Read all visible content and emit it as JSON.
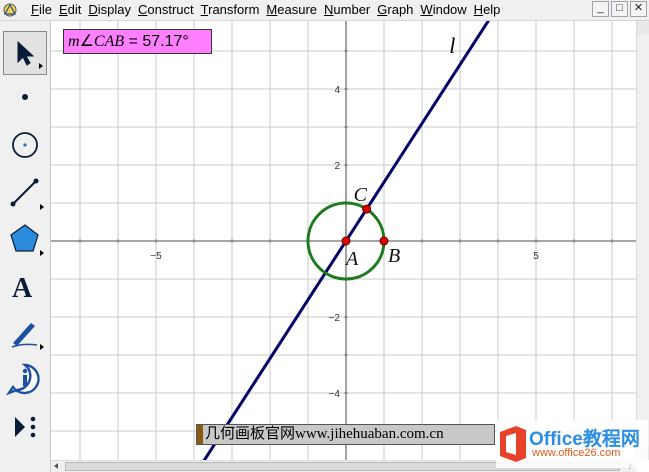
{
  "menu": {
    "items": [
      {
        "pre": "",
        "ul": "F",
        "post": "ile"
      },
      {
        "pre": "",
        "ul": "E",
        "post": "dit"
      },
      {
        "pre": "",
        "ul": "D",
        "post": "isplay"
      },
      {
        "pre": "",
        "ul": "C",
        "post": "onstruct"
      },
      {
        "pre": "",
        "ul": "T",
        "post": "ransform"
      },
      {
        "pre": "",
        "ul": "M",
        "post": "easure"
      },
      {
        "pre": "",
        "ul": "N",
        "post": "umber"
      },
      {
        "pre": "",
        "ul": "G",
        "post": "raph"
      },
      {
        "pre": "",
        "ul": "W",
        "post": "indow"
      },
      {
        "pre": "",
        "ul": "H",
        "post": "elp"
      }
    ],
    "window_buttons": [
      "_",
      "□",
      "✕"
    ]
  },
  "toolbox": {
    "tools": [
      {
        "name": "arrow-select-tool",
        "icon": "arrow-icon",
        "active": true
      },
      {
        "name": "point-tool",
        "icon": "point-icon",
        "active": false
      },
      {
        "name": "compass-tool",
        "icon": "compass-circle-icon",
        "active": false
      },
      {
        "name": "straightedge-tool",
        "icon": "segment-icon",
        "active": false
      },
      {
        "name": "polygon-tool",
        "icon": "polygon-icon",
        "active": false
      },
      {
        "name": "text-tool",
        "icon": "text-a-icon",
        "active": false
      },
      {
        "name": "marker-tool",
        "icon": "pen-icon",
        "active": false
      },
      {
        "name": "information-tool",
        "icon": "info-icon",
        "active": false
      },
      {
        "name": "custom-tool",
        "icon": "custom-tool-icon",
        "active": false
      }
    ],
    "text_tool_glyph": "A"
  },
  "measurement": {
    "m": "m",
    "angle": "∠",
    "name": "CAB",
    "value": " = 57.17°"
  },
  "graph": {
    "x_ticks": [
      "−5",
      "5"
    ],
    "y_ticks": [
      "4",
      "2",
      "−2",
      "−4"
    ],
    "x_range": [
      -5,
      5
    ],
    "origin_label_hint": "A",
    "points": [
      {
        "label": "A",
        "x": 0,
        "y": 0
      },
      {
        "label": "B",
        "x": 1,
        "y": 0
      },
      {
        "label": "C",
        "x": 0.5429,
        "y": 0.8398
      }
    ],
    "line_label": "l",
    "circle": {
      "center": "A",
      "radius": 1
    },
    "colors": {
      "line": "#000066",
      "circle": "#1e7a1e",
      "point": "#dd0000",
      "grid": "#c8c8c8",
      "axis": "#707070"
    }
  },
  "caption": {
    "text": "几何画板官网www.jihehuaban.com.cn"
  },
  "logo": {
    "title": "Office教程网",
    "url": "www.office26.com",
    "colors": {
      "red": "#e8412a",
      "blue": "#2d8ee0"
    }
  }
}
